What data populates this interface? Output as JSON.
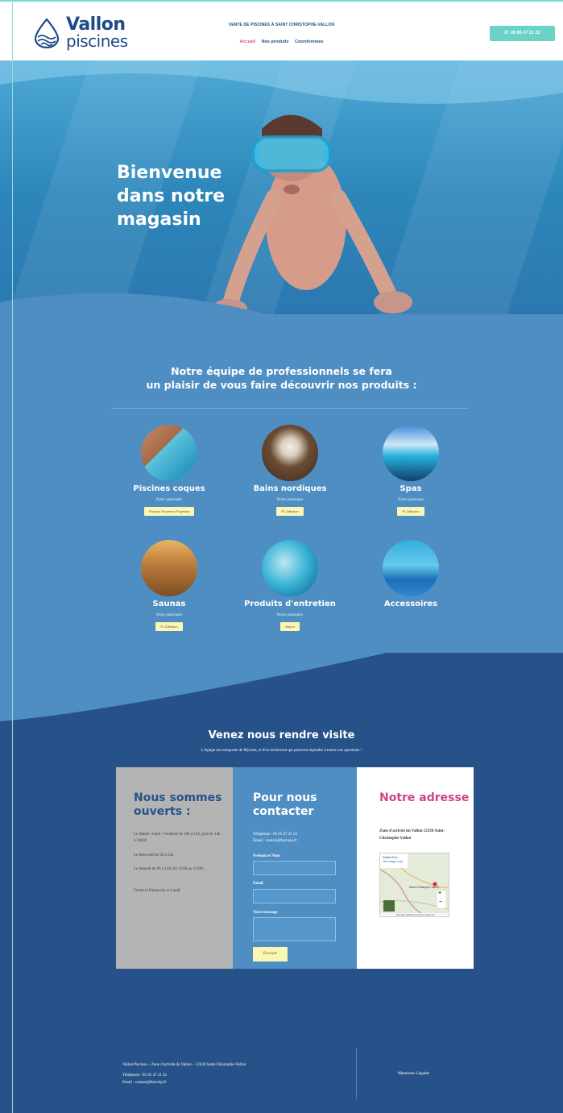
{
  "header": {
    "logo_line1": "Vallon",
    "logo_line2": "piscines",
    "tagline": "VENTE DE PISCINES À SAINT CHRISTOPHE-VALLON",
    "nav": [
      "Accueil",
      "Nos produits",
      "Coordonnées"
    ],
    "phone": "05 65 47 21 22"
  },
  "hero": {
    "title": "Bienvenue dans notre magasin"
  },
  "products": {
    "title_line1": "Notre équipe de professionnels se fera",
    "title_line2": "un plaisir de vous faire découvrir nos produits :",
    "partner_label": "Notre partenaire",
    "items": [
      {
        "name": "Piscines coques",
        "partner": "Piscines Provence Polyester"
      },
      {
        "name": "Bains nordiques",
        "partner": "PL Diffusion"
      },
      {
        "name": "Spas",
        "partner": "PL Diffusion"
      },
      {
        "name": "Saunas",
        "partner": "PL Diffusion"
      },
      {
        "name": "Produits d'entretien",
        "partner": "Bayrol"
      },
      {
        "name": "Accessoires",
        "partner": ""
      }
    ]
  },
  "visit": {
    "title": "Venez nous rendre visite",
    "subtitle": "L'équipe est composée de Myriam, et d'un technicien qui pourront répondre à toutes vos questions !",
    "open": {
      "title": "Nous sommes ouverts :",
      "lines": [
        "Le Mardi / Jeudi / Vendredi de 10h à 12h, puis de 14h à 18h30",
        "Le Mercredi de 9h à 12h",
        "Le Samedi de 9h à 12h (du 15/04 au 15/09)",
        "Fermé le Dimanche et Lundi"
      ]
    },
    "contact": {
      "title": "Pour nous contacter",
      "phone": "Téléphone : 05 65 47 21 22",
      "email": "Email : contact@barveip.fr",
      "field_name": "Prénom et Nom",
      "field_email": "Email",
      "field_message": "Votre message",
      "send": "Envoyer"
    },
    "address": {
      "title": "Notre adresse",
      "text": "Zone d'activité du Vallon 12330 Saint-Christophe-Vallon",
      "map_label_a": "Saint-Chri...",
      "map_label_b": "View larger map",
      "map_label_c": "Saint-Christophe-Vallon",
      "map_footer": "Map data ©2023 Terms Report a map error"
    }
  },
  "footer": {
    "line1": "Vallon Piscines – Zone d'activité du Vallon – 12330 Saint-Christophe-Vallon",
    "phone": "Téléphone : 05 65 47 21 22",
    "email": "Email : contact@barveip.fr",
    "legal": "Mentions Légales"
  },
  "colors": {
    "dark_blue": "#275289",
    "mid_blue": "#4f8ec3",
    "teal": "#6bd2c6",
    "pink": "#d0428a",
    "yellow": "#fbf6b4"
  }
}
